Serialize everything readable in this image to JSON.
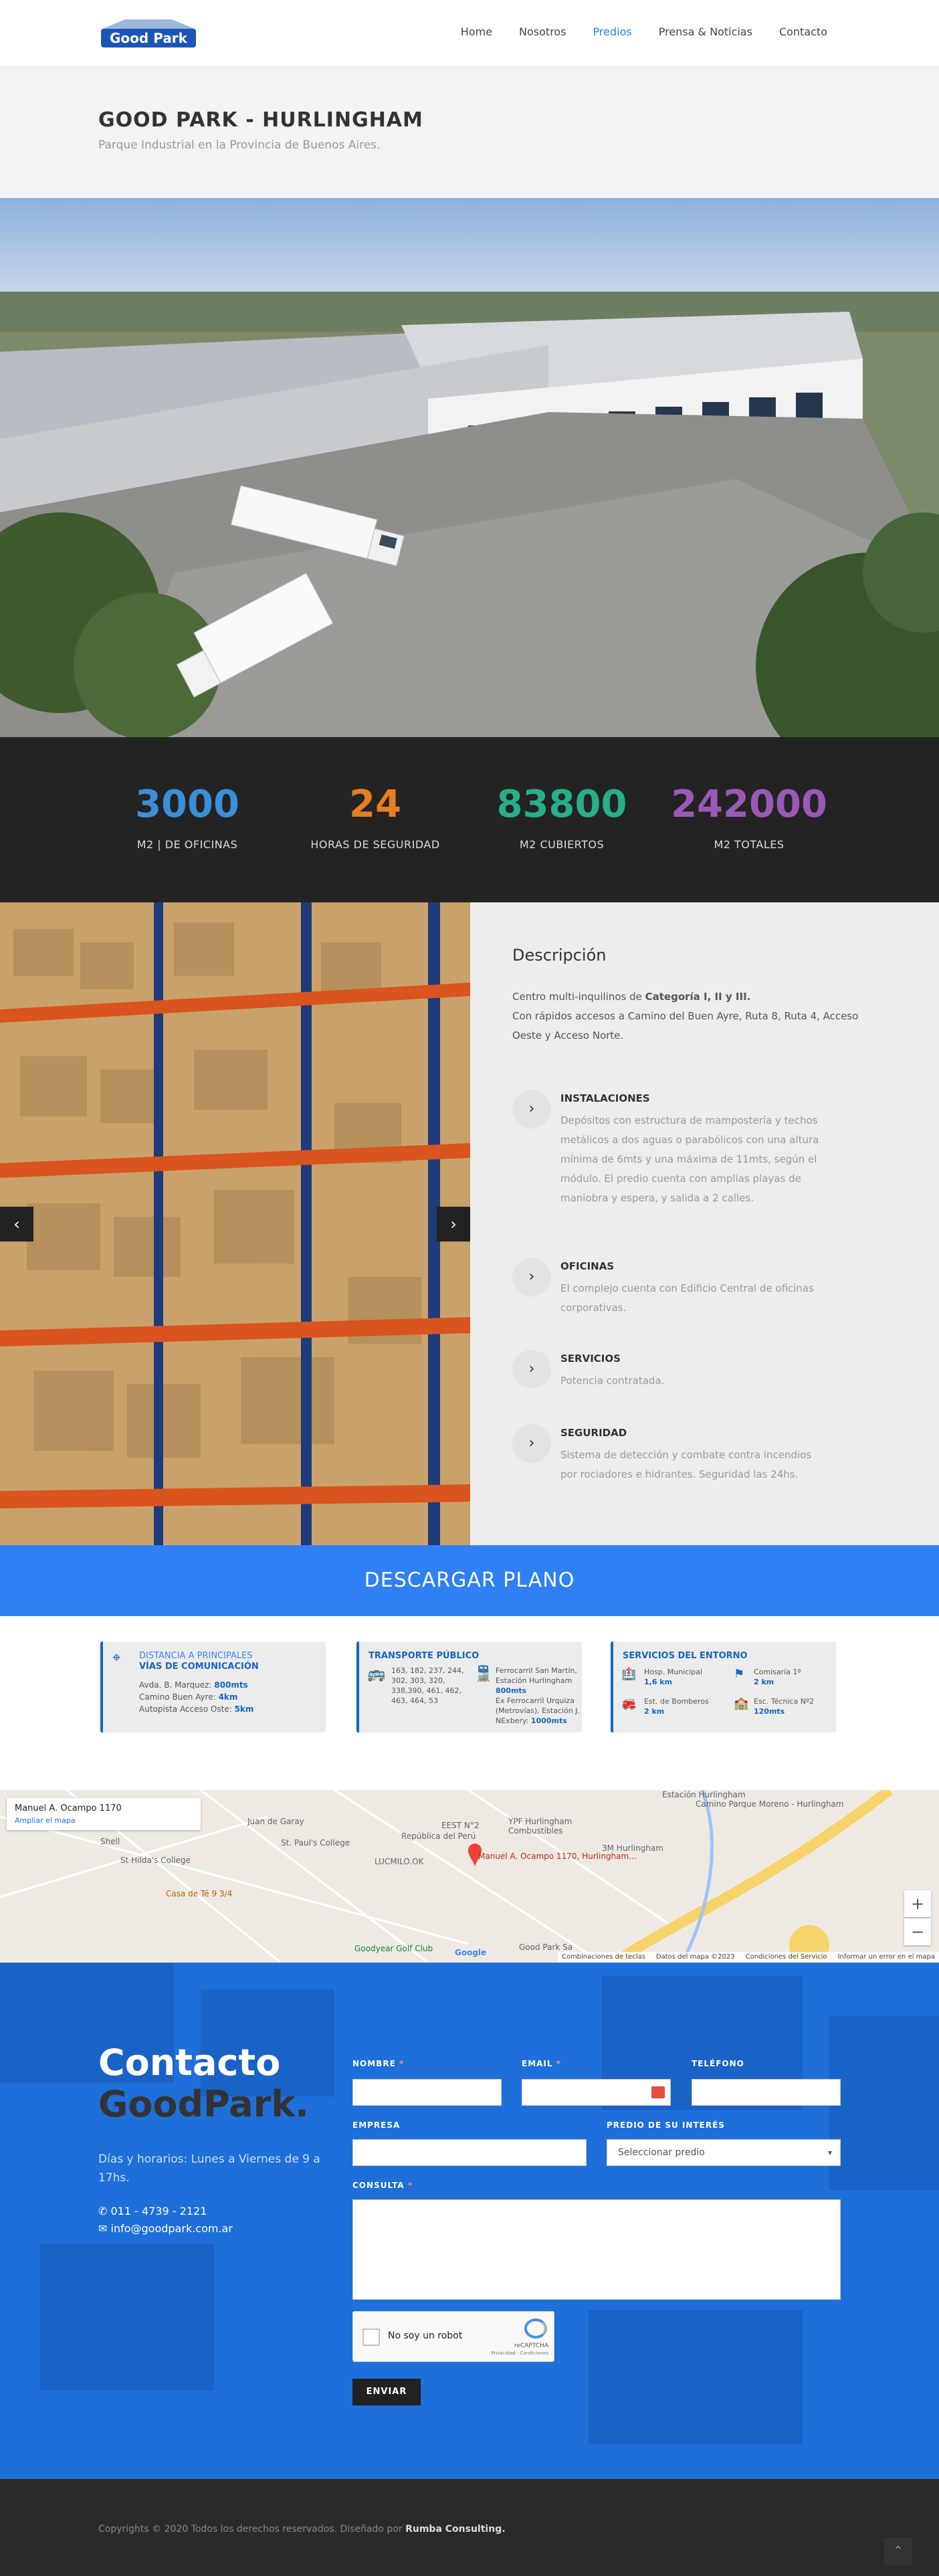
{
  "header": {
    "logo_text": "Good Park",
    "nav": [
      {
        "label": "Home"
      },
      {
        "label": "Nosotros"
      },
      {
        "label": "Predios"
      },
      {
        "label": "Prensa & Noticias"
      },
      {
        "label": "Contacto"
      }
    ],
    "active_nav": "Predios"
  },
  "title": {
    "heading": "GOOD PARK - HURLINGHAM",
    "subtitle": "Parque Industrial en la Provincia de Buenos Aires."
  },
  "stats": [
    {
      "value": "3000",
      "label": "M2 | DE OFICINAS",
      "color": "#3b8fd9"
    },
    {
      "value": "24",
      "label": "HORAS DE SEGURIDAD",
      "color": "#e67e22"
    },
    {
      "value": "83800",
      "label": "M2 CUBIERTOS",
      "color": "#27ae8a"
    },
    {
      "value": "242000",
      "label": "M2 TOTALES",
      "color": "#9b59b6"
    }
  ],
  "description": {
    "heading": "Descripción",
    "intro_prefix": "Centro multi-inquilinos de ",
    "intro_bold": "Categoría I, II y III.",
    "intro_rest": "Con rápidos accesos a Camino del Buen Ayre, Ruta 8, Ruta 4, Acceso Oeste y Acceso Norte.",
    "features": [
      {
        "title": "INSTALACIONES",
        "text": "Depósitos con estructura de mampostería y techos metálicos a dos aguas o parabólicos con una altura mínima de 6mts y una máxima de 11mts, según el módulo. El predio cuenta con amplias playas de maniobra y espera, y salida a 2 calles."
      },
      {
        "title": "OFICINAS",
        "text": "El complejo cuenta con Edificio Central de oficinas corporativas."
      },
      {
        "title": "SERVICIOS",
        "text": "Potencia contratada."
      },
      {
        "title": "SEGURIDAD",
        "text": "Sistema de detección y combate contra incendios por rociadores e hidrantes. Seguridad las 24hs."
      }
    ],
    "arrow_prev": "‹",
    "arrow_next": "›",
    "feature_icon": "›"
  },
  "download": {
    "label": "DESCARGAR PLANO"
  },
  "cards": {
    "communication": {
      "title_top": "DISTANCIA A PRINCIPALES",
      "title": "VÍAS DE COMUNICACIÓN",
      "rows": [
        {
          "label": "Avda. B. Marquez: ",
          "value": "800mts"
        },
        {
          "label": "Camino Buen Ayre: ",
          "value": "4km"
        },
        {
          "label": "Autopista Acceso Oste: ",
          "value": "5km"
        }
      ]
    },
    "transport": {
      "title": "TRANSPORTE PÚBLICO",
      "buses": "163, 182, 237, 244, 302, 303, 320, 338,390, 461, 462, 463, 464, 53",
      "train1": "Ferrocarril San Martín, Estación Hurlingham",
      "train1_dist": "800mts",
      "train2": "Ex Ferrocarril Urquiza (Metrovías), Estación J. NExbery: ",
      "train2_dist": "1000mts"
    },
    "services": {
      "title": "SERVICIOS DEL ENTORNO",
      "items": [
        {
          "label": "Hosp. Municipal",
          "value": "1,6 km"
        },
        {
          "label": "Comisaría 1º",
          "value": "2 km"
        },
        {
          "label": "Est. de Bomberos",
          "value": "2 km"
        },
        {
          "label": "Esc. Técnica Nº2",
          "value": "120mts"
        }
      ]
    }
  },
  "map": {
    "address": "Manuel A. Ocampo 1170",
    "enlarge": "Ampliar el mapa",
    "pin_label": "Manuel A. Ocampo 1170, Hurlingham...",
    "labels": [
      "St Hilda's College",
      "St. Paul's College",
      "República del Perú",
      "LUCMILO.OK",
      "EEST N°2",
      "YPF Hurlingham Combustibles",
      "3M Hurlingham",
      "Casa de Té 9 3/4",
      "Goodyear Golf Club",
      "Good Park Sa",
      "Shell",
      "Estación Hurlingham",
      "Juan de Garay",
      "Camino Parque Moreno - Hurlingham"
    ],
    "zoom_in": "+",
    "zoom_out": "−",
    "google": "Google",
    "footer": [
      "Combinaciones de teclas",
      "Datos del mapa ©2023",
      "Condiciones del Servicio",
      "Informar un error en el mapa"
    ]
  },
  "contact": {
    "title1": "Contacto",
    "title2": "GoodPark.",
    "hours": "Días y horarios: Lunes a Viernes de 9 a 17hs.",
    "phone": "011 - 4739 - 2121",
    "email": "info@goodpark.com.ar",
    "labels": {
      "nombre": "NOMBRE",
      "email": "EMAIL",
      "telefono": "TELÉFONO",
      "empresa": "EMPRESA",
      "predio": "PREDIO DE SU INTERÉS",
      "consulta": "CONSULTA"
    },
    "required_mark": "*",
    "predio_selected": "Seleccionar predio",
    "captcha_label": "No soy un robot",
    "captcha_brand": "reCAPTCHA",
    "captcha_terms": "Privacidad - Condiciones",
    "send_label": "ENVIAR"
  },
  "footer": {
    "copyright_prefix": "Copyrights © 2020 Todos los derechos reservados. Diseñado por ",
    "designer": "Rumba Consulting."
  }
}
